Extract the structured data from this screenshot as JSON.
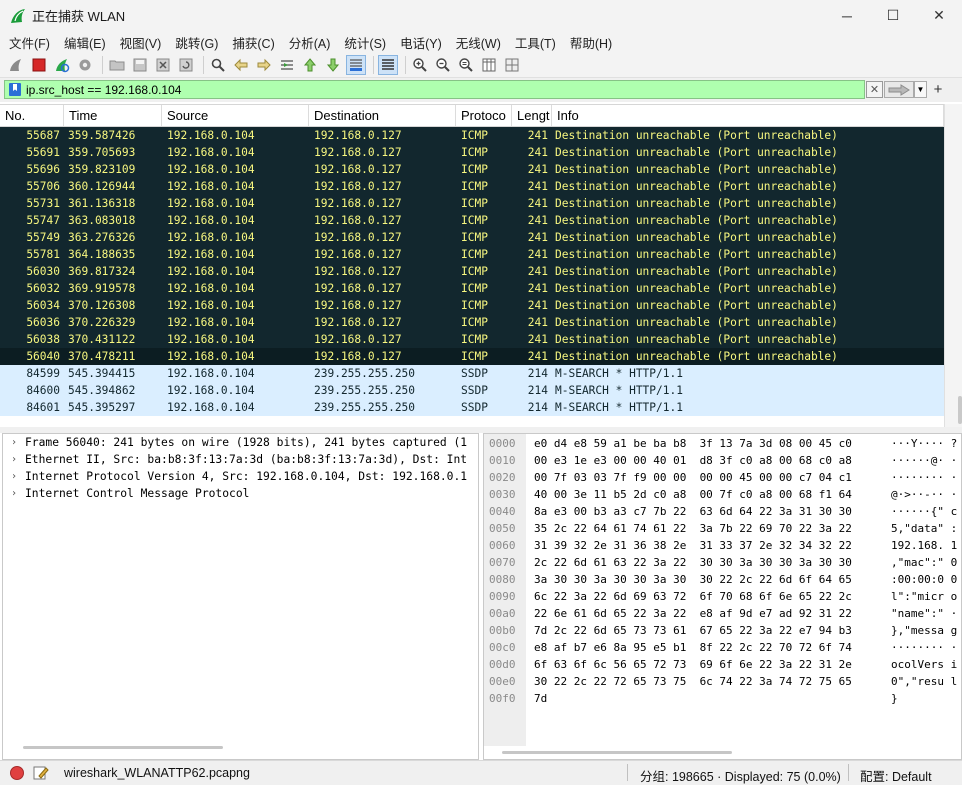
{
  "window": {
    "title": "正在捕获 WLAN",
    "minimize_glyph": "─",
    "maximize_glyph": "☐",
    "close_glyph": "✕"
  },
  "menu": [
    "文件(F)",
    "编辑(E)",
    "视图(V)",
    "跳转(G)",
    "捕获(C)",
    "分析(A)",
    "统计(S)",
    "电话(Y)",
    "无线(W)",
    "工具(T)",
    "帮助(H)"
  ],
  "toolbar_icons": [
    "shark-fin-start-icon",
    "stop-capture-icon",
    "restart-capture-icon",
    "capture-options-icon",
    "open-file-icon",
    "save-file-icon",
    "close-file-icon",
    "reload-file-icon",
    "find-packet-icon",
    "go-back-icon",
    "go-forward-icon",
    "go-to-packet-icon",
    "go-first-icon",
    "go-last-icon",
    "autoscroll-icon",
    "colorize-icon",
    "zoom-in-icon",
    "zoom-out-icon",
    "zoom-normal-icon",
    "resize-columns-icon",
    "layout-icon"
  ],
  "filter": {
    "value": "ip.src_host == 192.168.0.104",
    "color": "#afffaf"
  },
  "packet_list": {
    "columns": [
      "No.",
      "Time",
      "Source",
      "Destination",
      "Protoco",
      "Lengt",
      "Info"
    ],
    "rows": [
      {
        "no": "55687",
        "time": "359.587426",
        "src": "192.168.0.104",
        "dst": "192.168.0.127",
        "proto": "ICMP",
        "len": "241",
        "info": "Destination unreachable (Port unreachable)",
        "kind": "icmp"
      },
      {
        "no": "55691",
        "time": "359.705693",
        "src": "192.168.0.104",
        "dst": "192.168.0.127",
        "proto": "ICMP",
        "len": "241",
        "info": "Destination unreachable (Port unreachable)",
        "kind": "icmp"
      },
      {
        "no": "55696",
        "time": "359.823109",
        "src": "192.168.0.104",
        "dst": "192.168.0.127",
        "proto": "ICMP",
        "len": "241",
        "info": "Destination unreachable (Port unreachable)",
        "kind": "icmp"
      },
      {
        "no": "55706",
        "time": "360.126944",
        "src": "192.168.0.104",
        "dst": "192.168.0.127",
        "proto": "ICMP",
        "len": "241",
        "info": "Destination unreachable (Port unreachable)",
        "kind": "icmp"
      },
      {
        "no": "55731",
        "time": "361.136318",
        "src": "192.168.0.104",
        "dst": "192.168.0.127",
        "proto": "ICMP",
        "len": "241",
        "info": "Destination unreachable (Port unreachable)",
        "kind": "icmp"
      },
      {
        "no": "55747",
        "time": "363.083018",
        "src": "192.168.0.104",
        "dst": "192.168.0.127",
        "proto": "ICMP",
        "len": "241",
        "info": "Destination unreachable (Port unreachable)",
        "kind": "icmp"
      },
      {
        "no": "55749",
        "time": "363.276326",
        "src": "192.168.0.104",
        "dst": "192.168.0.127",
        "proto": "ICMP",
        "len": "241",
        "info": "Destination unreachable (Port unreachable)",
        "kind": "icmp"
      },
      {
        "no": "55781",
        "time": "364.188635",
        "src": "192.168.0.104",
        "dst": "192.168.0.127",
        "proto": "ICMP",
        "len": "241",
        "info": "Destination unreachable (Port unreachable)",
        "kind": "icmp"
      },
      {
        "no": "56030",
        "time": "369.817324",
        "src": "192.168.0.104",
        "dst": "192.168.0.127",
        "proto": "ICMP",
        "len": "241",
        "info": "Destination unreachable (Port unreachable)",
        "kind": "icmp"
      },
      {
        "no": "56032",
        "time": "369.919578",
        "src": "192.168.0.104",
        "dst": "192.168.0.127",
        "proto": "ICMP",
        "len": "241",
        "info": "Destination unreachable (Port unreachable)",
        "kind": "icmp"
      },
      {
        "no": "56034",
        "time": "370.126308",
        "src": "192.168.0.104",
        "dst": "192.168.0.127",
        "proto": "ICMP",
        "len": "241",
        "info": "Destination unreachable (Port unreachable)",
        "kind": "icmp"
      },
      {
        "no": "56036",
        "time": "370.226329",
        "src": "192.168.0.104",
        "dst": "192.168.0.127",
        "proto": "ICMP",
        "len": "241",
        "info": "Destination unreachable (Port unreachable)",
        "kind": "icmp"
      },
      {
        "no": "56038",
        "time": "370.431122",
        "src": "192.168.0.104",
        "dst": "192.168.0.127",
        "proto": "ICMP",
        "len": "241",
        "info": "Destination unreachable (Port unreachable)",
        "kind": "icmp"
      },
      {
        "no": "56040",
        "time": "370.478211",
        "src": "192.168.0.104",
        "dst": "192.168.0.127",
        "proto": "ICMP",
        "len": "241",
        "info": "Destination unreachable (Port unreachable)",
        "kind": "icmp",
        "selected": true
      },
      {
        "no": "84599",
        "time": "545.394415",
        "src": "192.168.0.104",
        "dst": "239.255.255.250",
        "proto": "SSDP",
        "len": "214",
        "info": "M-SEARCH * HTTP/1.1",
        "kind": "ssdp"
      },
      {
        "no": "84600",
        "time": "545.394862",
        "src": "192.168.0.104",
        "dst": "239.255.255.250",
        "proto": "SSDP",
        "len": "214",
        "info": "M-SEARCH * HTTP/1.1",
        "kind": "ssdp"
      },
      {
        "no": "84601",
        "time": "545.395297",
        "src": "192.168.0.104",
        "dst": "239.255.255.250",
        "proto": "SSDP",
        "len": "214",
        "info": "M-SEARCH * HTTP/1.1",
        "kind": "ssdp"
      }
    ]
  },
  "details": [
    {
      "text": "Frame 56040: 241 bytes on wire (1928 bits), 241 bytes captured (1",
      "arrow": "›"
    },
    {
      "text": "Ethernet II, Src: ba:b8:3f:13:7a:3d (ba:b8:3f:13:7a:3d), Dst: Int",
      "arrow": "›"
    },
    {
      "text": "Internet Protocol Version 4, Src: 192.168.0.104, Dst: 192.168.0.1",
      "arrow": "›"
    },
    {
      "text": "Internet Control Message Protocol",
      "arrow": "›"
    }
  ],
  "hex": [
    {
      "off": "0000",
      "bytes": "e0 d4 e8 59 a1 be ba b8  3f 13 7a 3d 08 00 45 c0",
      "ascii": "···Y···· ?"
    },
    {
      "off": "0010",
      "bytes": "00 e3 1e e3 00 00 40 01  d8 3f c0 a8 00 68 c0 a8",
      "ascii": "······@· ·"
    },
    {
      "off": "0020",
      "bytes": "00 7f 03 03 7f f9 00 00  00 00 45 00 00 c7 04 c1",
      "ascii": "········ ·"
    },
    {
      "off": "0030",
      "bytes": "40 00 3e 11 b5 2d c0 a8  00 7f c0 a8 00 68 f1 64",
      "ascii": "@·>··-·· ·"
    },
    {
      "off": "0040",
      "bytes": "8a e3 00 b3 a3 c7 7b 22  63 6d 64 22 3a 31 30 30",
      "ascii": "······{\" c"
    },
    {
      "off": "0050",
      "bytes": "35 2c 22 64 61 74 61 22  3a 7b 22 69 70 22 3a 22",
      "ascii": "5,\"data\" :"
    },
    {
      "off": "0060",
      "bytes": "31 39 32 2e 31 36 38 2e  31 33 37 2e 32 34 32 22",
      "ascii": "192.168. 1"
    },
    {
      "off": "0070",
      "bytes": "2c 22 6d 61 63 22 3a 22  30 30 3a 30 30 3a 30 30",
      "ascii": ",\"mac\":\" 0"
    },
    {
      "off": "0080",
      "bytes": "3a 30 30 3a 30 30 3a 30  30 22 2c 22 6d 6f 64 65",
      "ascii": ":00:00:0 0"
    },
    {
      "off": "0090",
      "bytes": "6c 22 3a 22 6d 69 63 72  6f 70 68 6f 6e 65 22 2c",
      "ascii": "l\":\"micr o"
    },
    {
      "off": "00a0",
      "bytes": "22 6e 61 6d 65 22 3a 22  e8 af 9d e7 ad 92 31 22",
      "ascii": "\"name\":\" ·"
    },
    {
      "off": "00b0",
      "bytes": "7d 2c 22 6d 65 73 73 61  67 65 22 3a 22 e7 94 b3",
      "ascii": "},\"messa g"
    },
    {
      "off": "00c0",
      "bytes": "e8 af b7 e6 8a 95 e5 b1  8f 22 2c 22 70 72 6f 74",
      "ascii": "········ ·"
    },
    {
      "off": "00d0",
      "bytes": "6f 63 6f 6c 56 65 72 73  69 6f 6e 22 3a 22 31 2e",
      "ascii": "ocolVers i"
    },
    {
      "off": "00e0",
      "bytes": "30 22 2c 22 72 65 73 75  6c 74 22 3a 74 72 75 65",
      "ascii": "0\",\"resu l"
    },
    {
      "off": "00f0",
      "bytes": "7d",
      "ascii": "}"
    }
  ],
  "status": {
    "file": "wireshark_WLANATTP62.pcapng",
    "packets": "分组: 198665 · Displayed: 75 (0.0%)",
    "profile": "配置: Default"
  },
  "colors": {
    "icmp_bg": "#12272e",
    "icmp_fg": "#f7f780",
    "ssdp_bg": "#daeeff",
    "ssdp_fg": "#12272e"
  }
}
